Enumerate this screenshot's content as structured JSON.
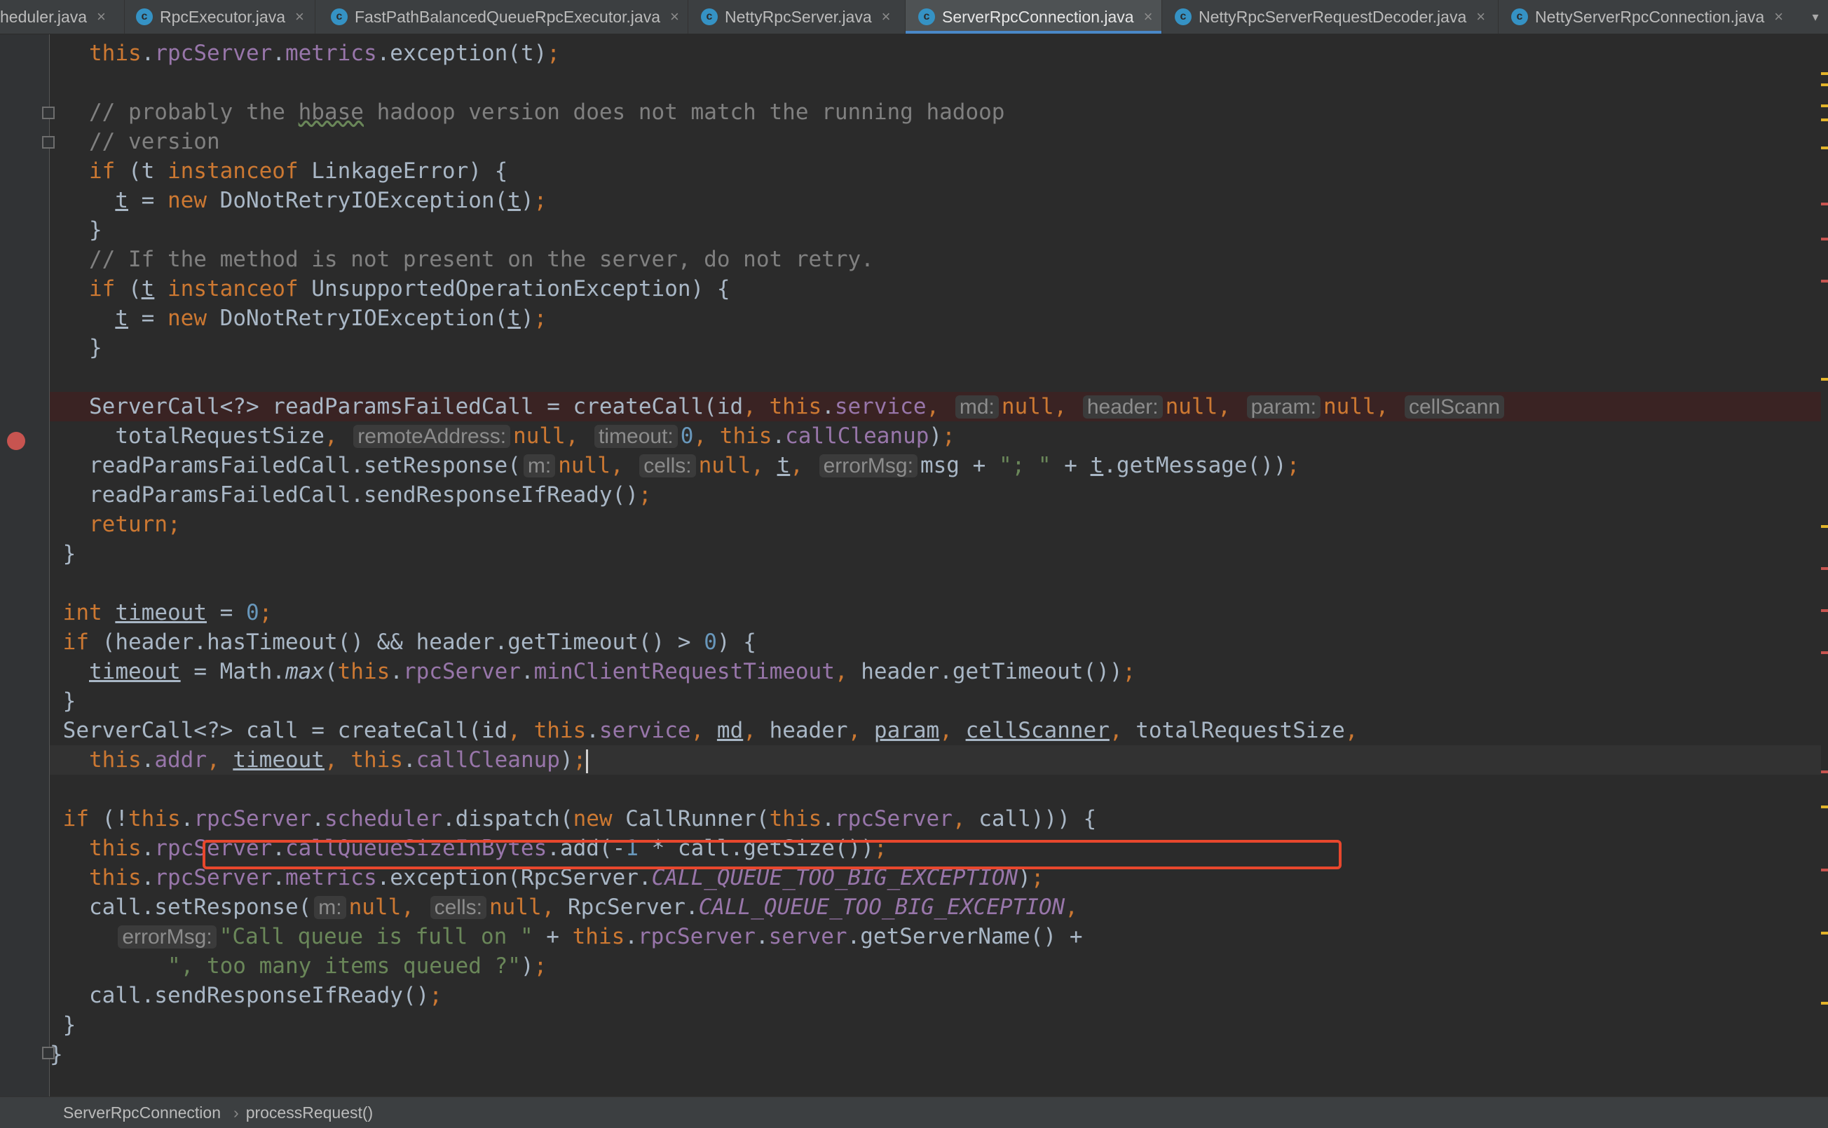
{
  "tabs": [
    {
      "label": "heduler.java",
      "close": "×"
    },
    {
      "label": "RpcExecutor.java",
      "close": "×"
    },
    {
      "label": "FastPathBalancedQueueRpcExecutor.java",
      "close": "×"
    },
    {
      "label": "NettyRpcServer.java",
      "close": "×"
    },
    {
      "label": "ServerRpcConnection.java",
      "close": "×"
    },
    {
      "label": "NettyRpcServerRequestDecoder.java",
      "close": "×"
    },
    {
      "label": "NettyServerRpcConnection.java",
      "close": "×"
    }
  ],
  "tab_menu_icon": "▾",
  "breadcrumb": {
    "class_name": "ServerRpcConnection",
    "separator": "›",
    "method_name": "processRequest()"
  },
  "hints": {
    "md": "md:",
    "header": "header:",
    "param": "param:",
    "cellScann": "cellScann",
    "remoteAddress": "remoteAddress:",
    "timeout": "timeout:",
    "m": "m:",
    "cells": "cells:",
    "errorMsg": "errorMsg:"
  },
  "colors": {
    "keyword": "#cc7832",
    "field": "#9876aa",
    "comment": "#808080",
    "number": "#6897bb",
    "string": "#6a8759",
    "highlight_box": "#e8472d",
    "breakpoint": "#c75450"
  }
}
